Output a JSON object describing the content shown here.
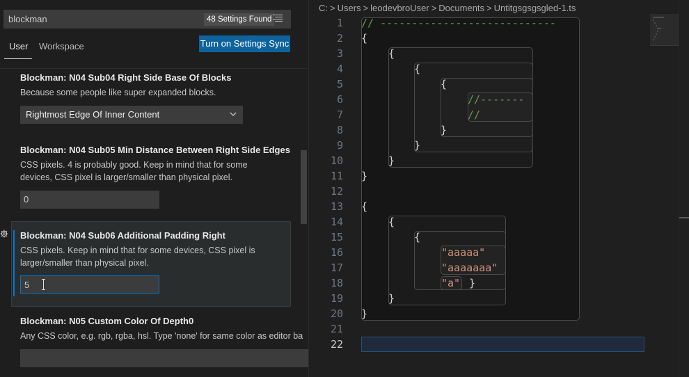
{
  "settings": {
    "search": {
      "value": "blockman",
      "results_badge": "48 Settings Found"
    },
    "tabs": [
      {
        "label": "User",
        "active": true
      },
      {
        "label": "Workspace",
        "active": false
      }
    ],
    "sync_button_label": "Turn on Settings Sync",
    "items": [
      {
        "prefix": "Blockman: ",
        "title": "N04 Sub04 Right Side Base Of Blocks",
        "description": [
          "Because some people like super expanded blocks."
        ],
        "control": "select",
        "value": "Rightmost Edge Of Inner Content"
      },
      {
        "prefix": "Blockman: ",
        "title": "N04 Sub05 Min Distance Between Right Side Edges",
        "description": [
          "CSS pixels. 4 is probably good. Keep in mind that for some",
          "devices, CSS pixel is larger/smaller than physical pixel."
        ],
        "control": "input",
        "value": "0"
      },
      {
        "prefix": "Blockman: ",
        "title": "N04 Sub06 Additional Padding Right",
        "description": [
          "CSS pixels. Keep in mind that for some devices, CSS pixel is",
          "larger/smaller than physical pixel."
        ],
        "control": "input",
        "value": "5",
        "focused": true
      },
      {
        "prefix": "Blockman: ",
        "title": "N05 Custom Color Of Depth0",
        "description": [
          "Any CSS color, e.g. rgb, rgba, hsl. Type 'none' for same color as editor ba"
        ],
        "control": "input",
        "value": ""
      }
    ]
  },
  "editor": {
    "breadcrumb": [
      "C:",
      "Users",
      "leodevbroUser",
      "Documents",
      "Untitgsgsgsgled-1.ts"
    ],
    "active_line": 22,
    "line_numbers": [
      "1",
      "2",
      "3",
      "4",
      "5",
      "6",
      "7",
      "8",
      "9",
      "10",
      "11",
      "12",
      "13",
      "14",
      "15",
      "16",
      "17",
      "18",
      "19",
      "20",
      "21",
      "22"
    ],
    "code": {
      "l1": "// ----------------------------",
      "l2": "{",
      "l3": "{",
      "l4": "{",
      "l5": "{",
      "l6": "//-------",
      "l7": "//",
      "l8": "}",
      "l9": "}",
      "l10": "}",
      "l11": "}",
      "l13": "{",
      "l14": "{",
      "l15": "{",
      "l16": "\"aaaaa\"",
      "l17": "\"aaaaaaa\"",
      "l18a": "\"a\"",
      "l18b": "}",
      "l19": "}",
      "l20": "}"
    }
  },
  "colors": {
    "accent": "#0078d4",
    "button": "#0e639c",
    "comment": "#6a9955",
    "string": "#ce9178",
    "block_border": "#4a4a4a"
  }
}
